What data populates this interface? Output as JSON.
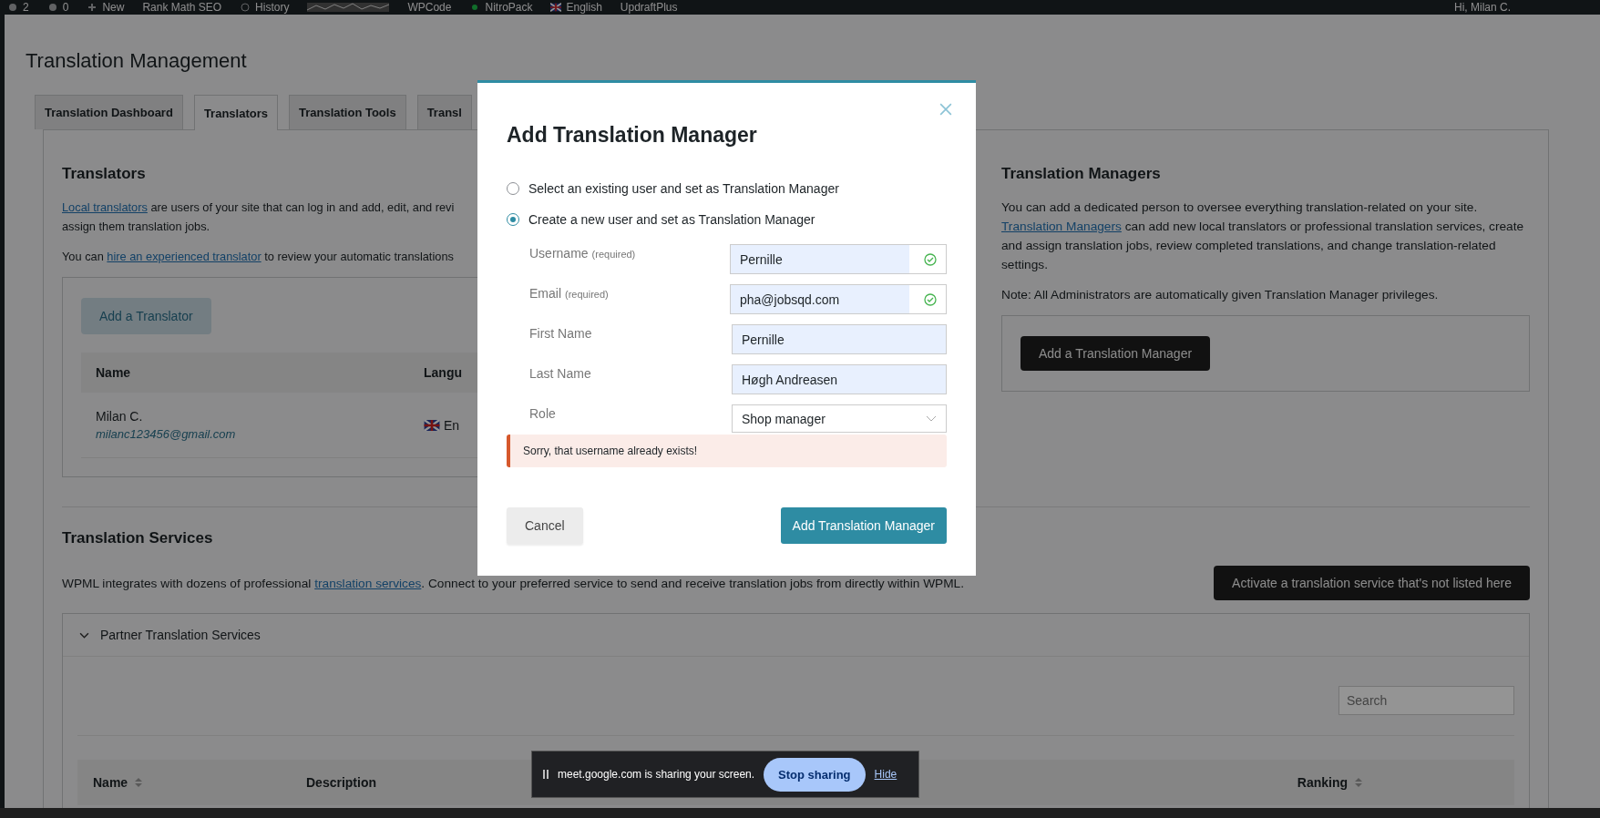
{
  "admin_bar": {
    "items": [
      {
        "kind": "icon-count",
        "label": "2"
      },
      {
        "kind": "icon-count",
        "label": "0"
      },
      {
        "kind": "plus",
        "label": "New"
      },
      {
        "kind": "text",
        "label": "Rank Math SEO"
      },
      {
        "kind": "clock",
        "label": "History"
      },
      {
        "kind": "graph"
      },
      {
        "kind": "text",
        "label": "WPCode"
      },
      {
        "kind": "dot",
        "label": "NitroPack"
      },
      {
        "kind": "flag",
        "label": "English"
      },
      {
        "kind": "text",
        "label": "UpdraftPlus"
      }
    ],
    "greeting": "Hi, Milan C."
  },
  "page_title": "Translation Management",
  "tabs": [
    {
      "label": "Translation Dashboard",
      "selected": false
    },
    {
      "label": "Translators",
      "selected": true
    },
    {
      "label": "Translation Tools",
      "selected": false
    },
    {
      "label": "Transl",
      "selected": false
    }
  ],
  "translators": {
    "heading": "Translators",
    "para1_link": "Local translators",
    "para1_text": "are users of your site that can log in and add, edit, and revi",
    "para1_line2": "assign them translation jobs.",
    "para2_before": "You can",
    "para2_link": "hire an experienced translator",
    "para2_after": "to review your automatic translations",
    "add_button": "Add a Translator",
    "columns": [
      "Name",
      "Langu"
    ],
    "rows": [
      {
        "name": "Milan C.",
        "email": "milanc123456@gmail.com",
        "language": "En"
      }
    ]
  },
  "managers": {
    "heading": "Translation Managers",
    "para_line1": "You can add a dedicated person to oversee everything translation-related on your site.",
    "para_link": "Translation Managers",
    "para_rest": "can add new local translators or professional translation services, create and assign translation jobs, review completed translations, and change translation-related settings.",
    "note": "Note: All Administrators are automatically given Translation Manager privileges.",
    "add_button": "Add a Translation Manager"
  },
  "services": {
    "heading": "Translation Services",
    "para_before": "WPML integrates with dozens of professional",
    "para_link": "translation services",
    "para_after": ". Connect to your preferred service to send and receive translation jobs from directly within WPML.",
    "activate_button": "Activate a translation service that's not listed here",
    "partner": {
      "title": "Partner Translation Services",
      "expanded": true,
      "search_placeholder": "Search",
      "columns": [
        {
          "label": "Name",
          "sortable": true
        },
        {
          "label": "Description",
          "sortable": false
        },
        {
          "label": "Ranking",
          "sortable": true
        }
      ]
    }
  },
  "dialog": {
    "title": "Add Translation Manager",
    "options": [
      {
        "label": "Select an existing user and set as Translation Manager",
        "selected": false
      },
      {
        "label": "Create a new user and set as Translation Manager",
        "selected": true
      }
    ],
    "fields": [
      {
        "kind": "text",
        "label": "Username",
        "hint": "(required)",
        "value": "Pernille",
        "valid": true
      },
      {
        "kind": "text",
        "label": "Email",
        "hint": "(required)",
        "value": "pha@jobsqd.com",
        "valid": true
      },
      {
        "kind": "text",
        "label": "First Name",
        "value": "Pernille",
        "valid": false
      },
      {
        "kind": "text",
        "label": "Last Name",
        "value": "Høgh Andreasen",
        "valid": false
      },
      {
        "kind": "select",
        "label": "Role",
        "value": "Shop manager"
      }
    ],
    "error": "Sorry, that username already exists!",
    "cancel": "Cancel",
    "submit": "Add Translation Manager"
  },
  "share_bar": {
    "message": "meet.google.com is sharing your screen.",
    "stop": "Stop sharing",
    "hide": "Hide"
  }
}
